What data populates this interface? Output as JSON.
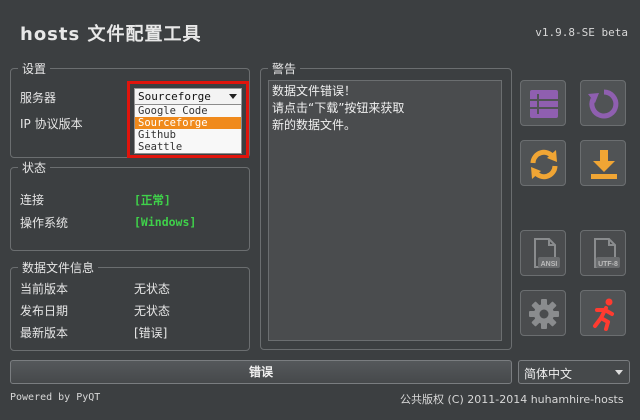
{
  "app": {
    "title": "hosts 文件配置工具",
    "version": "v1.9.8-SE beta"
  },
  "settings": {
    "legend": "设置",
    "server_label": "服务器",
    "ip_label": "IP 协议版本",
    "server_selected": "Sourceforge",
    "server_options": [
      "Google Code",
      "Sourceforge",
      "Github",
      "Seattle"
    ]
  },
  "status": {
    "legend": "状态",
    "connection_label": "连接",
    "connection_value": "[正常]",
    "os_label": "操作系统",
    "os_value": "[Windows]"
  },
  "datafile": {
    "legend": "数据文件信息",
    "current_label": "当前版本",
    "current_value": "无状态",
    "release_label": "发布日期",
    "release_value": "无状态",
    "latest_label": "最新版本",
    "latest_value": "[错误]"
  },
  "warning": {
    "legend": "警告",
    "lines": [
      "数据文件错误！",
      "请点击“下载”按钮来获取",
      "新的数据文件。"
    ]
  },
  "buttons": {
    "function_label": "错误"
  },
  "language": {
    "selected": "简体中文"
  },
  "footer": {
    "left": "Powered by PyQT",
    "right": "公共版权 (C) 2011-2014 huhamhire-hosts"
  },
  "icons": {
    "tile_color": "#8f5fb0",
    "accent_orange": "#f0a534",
    "exit_red": "#ff3b30",
    "ok_green": "#3fd14a",
    "tiles": [
      "list-icon",
      "refresh-icon",
      "sync-icon",
      "download-icon",
      "ansi-file-icon",
      "utf8-file-icon",
      "settings-gear-icon",
      "exit-running-man-icon"
    ],
    "badges": [
      "ANSI",
      "UTF-8"
    ]
  }
}
